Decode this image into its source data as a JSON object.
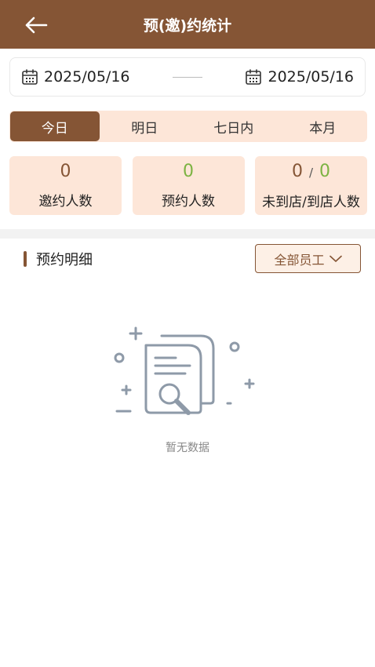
{
  "header": {
    "title": "预(邀)约统计",
    "back_icon": "arrow-left-icon"
  },
  "date_range": {
    "start": "2025/05/16",
    "end": "2025/05/16",
    "icon": "calendar-icon"
  },
  "tabs": [
    {
      "label": "今日",
      "active": true
    },
    {
      "label": "明日",
      "active": false
    },
    {
      "label": "七日内",
      "active": false
    },
    {
      "label": "本月",
      "active": false
    }
  ],
  "stats": {
    "invited": {
      "value": "0",
      "label": "邀约人数"
    },
    "reserved": {
      "value": "0",
      "label": "预约人数"
    },
    "arrival": {
      "not_arrived": "0",
      "separator": "/",
      "arrived": "0",
      "label": "未到店/到店人数"
    }
  },
  "section": {
    "title": "预约明细"
  },
  "staff_filter": {
    "label": "全部员工",
    "icon": "chevron-down-icon"
  },
  "empty_state": {
    "text": "暂无数据",
    "icon": "document-search-icon"
  },
  "colors": {
    "brand": "#855535",
    "tab_bg": "#fde6d8",
    "green": "#7cb342"
  }
}
